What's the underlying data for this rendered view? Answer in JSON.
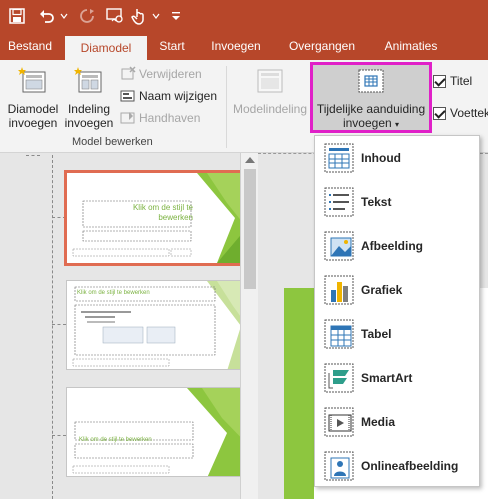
{
  "qat": {
    "icons": [
      "save-icon",
      "undo-icon",
      "redo-icon",
      "touch-mode-icon",
      "customize-qat-icon"
    ]
  },
  "tabs": [
    {
      "label": "Bestand",
      "active": false
    },
    {
      "label": "Diamodel",
      "active": true
    },
    {
      "label": "Start",
      "active": false
    },
    {
      "label": "Invoegen",
      "active": false
    },
    {
      "label": "Overgangen",
      "active": false
    },
    {
      "label": "Animaties",
      "active": false
    }
  ],
  "ribbon": {
    "insert_slide_master": {
      "line1": "Diamodel",
      "line2": "invoegen"
    },
    "insert_layout": {
      "line1": "Indeling",
      "line2": "invoegen"
    },
    "delete": "Verwijderen",
    "rename": "Naam wijzigen",
    "preserve": "Handhaven",
    "group_label": "Model bewerken",
    "master_layout": "Modelindeling",
    "insert_placeholder": {
      "line1": "Tijdelijke aanduiding",
      "line2": "invoegen"
    },
    "title_checkbox": "Titel",
    "footer_checkbox": "Voettek"
  },
  "thumbnails": [
    {
      "title": "Klik om de stijl te bewerken",
      "selected": true
    },
    {
      "title": "Klik om de stijl te bewerken",
      "selected": false
    },
    {
      "title": "Klik om de stijl te bewerken",
      "selected": false
    }
  ],
  "dropdown": {
    "items": [
      {
        "label": "Inhoud",
        "icon": "content-placeholder-icon"
      },
      {
        "label": "Tekst",
        "icon": "text-placeholder-icon"
      },
      {
        "label": "Afbeelding",
        "icon": "picture-placeholder-icon"
      },
      {
        "label": "Grafiek",
        "icon": "chart-placeholder-icon"
      },
      {
        "label": "Tabel",
        "icon": "table-placeholder-icon"
      },
      {
        "label": "SmartArt",
        "icon": "smartart-placeholder-icon"
      },
      {
        "label": "Media",
        "icon": "media-placeholder-icon"
      },
      {
        "label": "Onlineafbeelding",
        "icon": "online-picture-placeholder-icon"
      }
    ]
  },
  "colors": {
    "accent": "#b7472a",
    "highlight": "#e020c8",
    "slide_green": "#8dc63f",
    "selected_outline": "#e06c52"
  }
}
